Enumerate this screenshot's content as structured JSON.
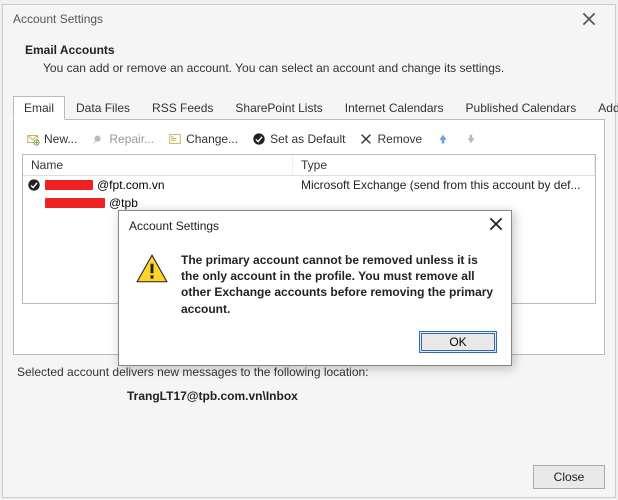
{
  "window": {
    "title": "Account Settings"
  },
  "header": {
    "title": "Email Accounts",
    "subtitle": "You can add or remove an account. You can select an account and change its settings."
  },
  "tabs": [
    {
      "label": "Email",
      "active": true
    },
    {
      "label": "Data Files"
    },
    {
      "label": "RSS Feeds"
    },
    {
      "label": "SharePoint Lists"
    },
    {
      "label": "Internet Calendars"
    },
    {
      "label": "Published Calendars"
    },
    {
      "label": "Address Books"
    }
  ],
  "toolbar": {
    "new": "New...",
    "repair": "Repair...",
    "change": "Change...",
    "set_default": "Set as Default",
    "remove": "Remove"
  },
  "table": {
    "columns": {
      "name": "Name",
      "type": "Type"
    },
    "rows": [
      {
        "suffix": "@fpt.com.vn",
        "type": "Microsoft Exchange (send from this account by def...",
        "default": true
      },
      {
        "suffix": "@tpb",
        "type": "",
        "default": false
      }
    ]
  },
  "below": {
    "line": "Selected account delivers new messages to the following location:",
    "location": "TrangLT17@tpb.com.vn\\Inbox"
  },
  "footer": {
    "close": "Close"
  },
  "modal": {
    "title": "Account Settings",
    "message": "The primary account cannot be removed unless it is the only account in the profile. You must remove all other Exchange accounts before removing the primary account.",
    "ok": "OK"
  }
}
